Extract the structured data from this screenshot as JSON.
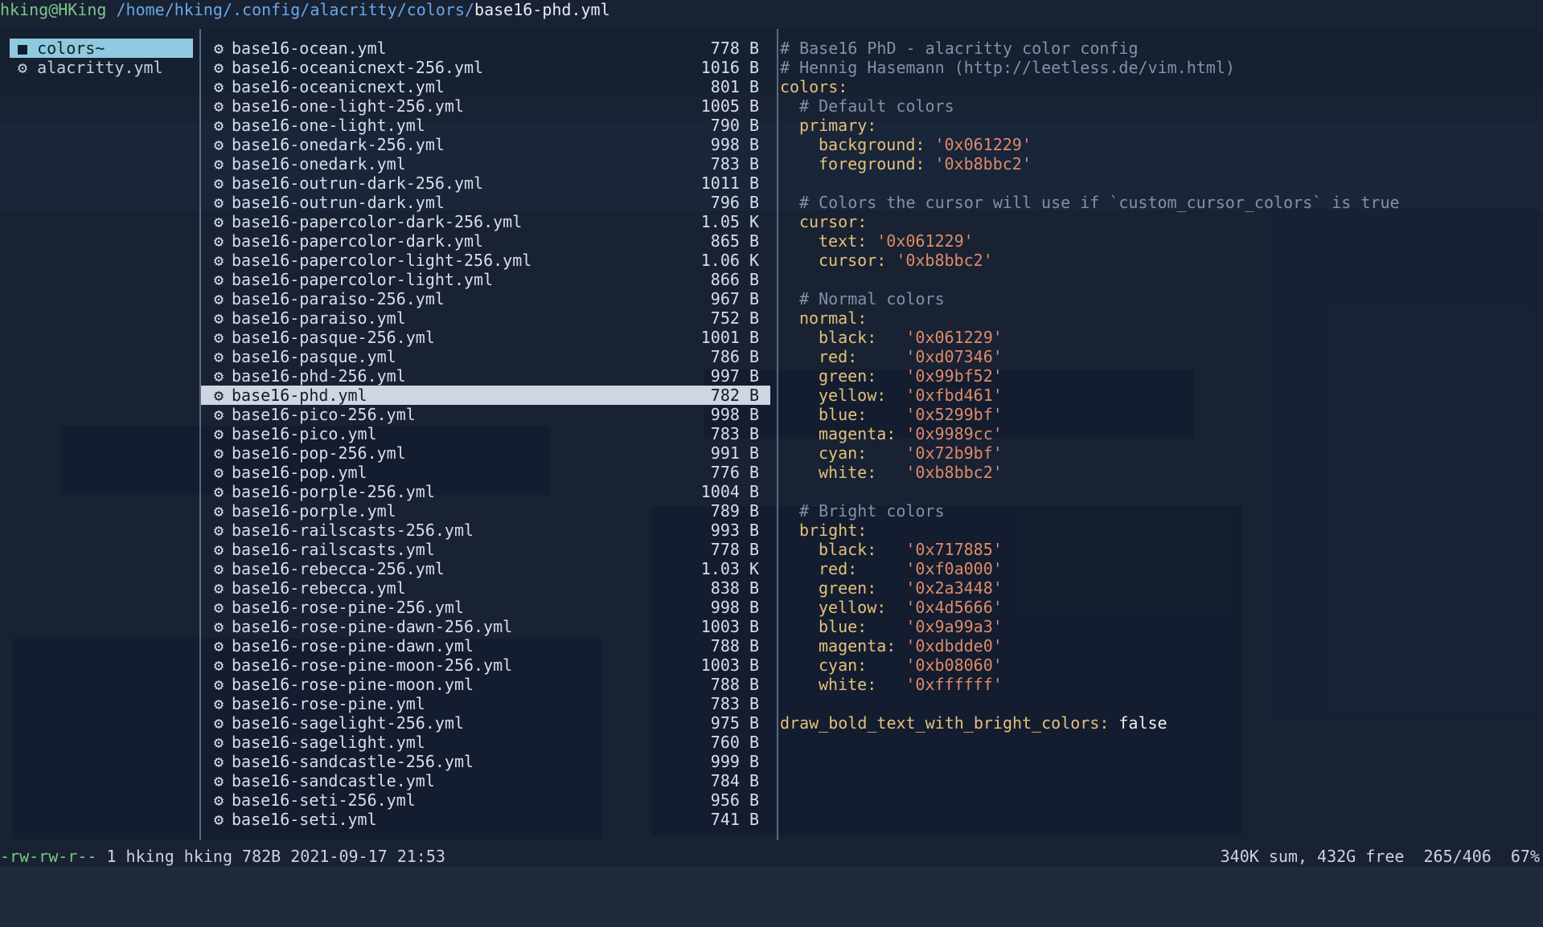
{
  "header": {
    "user_host": "hking@HKing",
    "path": "/home/hking/.config/alacritty/colors/",
    "file": "base16-phd.yml"
  },
  "parent_dir": [
    {
      "icon": "folder-icon",
      "name": "colors~",
      "selected": true
    },
    {
      "icon": "gear-icon",
      "name": "alacritty.yml",
      "selected": false
    }
  ],
  "files": [
    {
      "name": "base16-ocean.yml",
      "size": "778 B"
    },
    {
      "name": "base16-oceanicnext-256.yml",
      "size": "1016 B"
    },
    {
      "name": "base16-oceanicnext.yml",
      "size": "801 B"
    },
    {
      "name": "base16-one-light-256.yml",
      "size": "1005 B"
    },
    {
      "name": "base16-one-light.yml",
      "size": "790 B"
    },
    {
      "name": "base16-onedark-256.yml",
      "size": "998 B"
    },
    {
      "name": "base16-onedark.yml",
      "size": "783 B"
    },
    {
      "name": "base16-outrun-dark-256.yml",
      "size": "1011 B"
    },
    {
      "name": "base16-outrun-dark.yml",
      "size": "796 B"
    },
    {
      "name": "base16-papercolor-dark-256.yml",
      "size": "1.05 K"
    },
    {
      "name": "base16-papercolor-dark.yml",
      "size": "865 B"
    },
    {
      "name": "base16-papercolor-light-256.yml",
      "size": "1.06 K"
    },
    {
      "name": "base16-papercolor-light.yml",
      "size": "866 B"
    },
    {
      "name": "base16-paraiso-256.yml",
      "size": "967 B"
    },
    {
      "name": "base16-paraiso.yml",
      "size": "752 B"
    },
    {
      "name": "base16-pasque-256.yml",
      "size": "1001 B"
    },
    {
      "name": "base16-pasque.yml",
      "size": "786 B"
    },
    {
      "name": "base16-phd-256.yml",
      "size": "997 B"
    },
    {
      "name": "base16-phd.yml",
      "size": "782 B",
      "selected": true
    },
    {
      "name": "base16-pico-256.yml",
      "size": "998 B"
    },
    {
      "name": "base16-pico.yml",
      "size": "783 B"
    },
    {
      "name": "base16-pop-256.yml",
      "size": "991 B"
    },
    {
      "name": "base16-pop.yml",
      "size": "776 B"
    },
    {
      "name": "base16-porple-256.yml",
      "size": "1004 B"
    },
    {
      "name": "base16-porple.yml",
      "size": "789 B"
    },
    {
      "name": "base16-railscasts-256.yml",
      "size": "993 B"
    },
    {
      "name": "base16-railscasts.yml",
      "size": "778 B"
    },
    {
      "name": "base16-rebecca-256.yml",
      "size": "1.03 K"
    },
    {
      "name": "base16-rebecca.yml",
      "size": "838 B"
    },
    {
      "name": "base16-rose-pine-256.yml",
      "size": "998 B"
    },
    {
      "name": "base16-rose-pine-dawn-256.yml",
      "size": "1003 B"
    },
    {
      "name": "base16-rose-pine-dawn.yml",
      "size": "788 B"
    },
    {
      "name": "base16-rose-pine-moon-256.yml",
      "size": "1003 B"
    },
    {
      "name": "base16-rose-pine-moon.yml",
      "size": "788 B"
    },
    {
      "name": "base16-rose-pine.yml",
      "size": "783 B"
    },
    {
      "name": "base16-sagelight-256.yml",
      "size": "975 B"
    },
    {
      "name": "base16-sagelight.yml",
      "size": "760 B"
    },
    {
      "name": "base16-sandcastle-256.yml",
      "size": "999 B"
    },
    {
      "name": "base16-sandcastle.yml",
      "size": "784 B"
    },
    {
      "name": "base16-seti-256.yml",
      "size": "956 B"
    },
    {
      "name": "base16-seti.yml",
      "size": "741 B"
    }
  ],
  "preview": [
    {
      "type": "comment",
      "indent": 0,
      "text": "# Base16 PhD - alacritty color config"
    },
    {
      "type": "comment",
      "indent": 0,
      "text": "# Hennig Hasemann (http://leetless.de/vim.html)"
    },
    {
      "type": "key",
      "indent": 0,
      "key": "colors:",
      "value": ""
    },
    {
      "type": "comment",
      "indent": 1,
      "text": "# Default colors"
    },
    {
      "type": "key",
      "indent": 1,
      "key": "primary:",
      "value": ""
    },
    {
      "type": "key",
      "indent": 2,
      "key": "background:",
      "value": "'0x061229'"
    },
    {
      "type": "key",
      "indent": 2,
      "key": "foreground:",
      "value": "'0xb8bbc2'"
    },
    {
      "type": "blank"
    },
    {
      "type": "comment",
      "indent": 1,
      "text": "# Colors the cursor will use if `custom_cursor_colors` is true"
    },
    {
      "type": "key",
      "indent": 1,
      "key": "cursor:",
      "value": ""
    },
    {
      "type": "key",
      "indent": 2,
      "key": "text:",
      "value": "'0x061229'"
    },
    {
      "type": "key",
      "indent": 2,
      "key": "cursor:",
      "value": "'0xb8bbc2'"
    },
    {
      "type": "blank"
    },
    {
      "type": "comment",
      "indent": 1,
      "text": "# Normal colors"
    },
    {
      "type": "key",
      "indent": 1,
      "key": "normal:",
      "value": ""
    },
    {
      "type": "key",
      "indent": 2,
      "key": "black:",
      "value": "'0x061229'"
    },
    {
      "type": "key",
      "indent": 2,
      "key": "red:",
      "value": "'0xd07346'"
    },
    {
      "type": "key",
      "indent": 2,
      "key": "green:",
      "value": "'0x99bf52'"
    },
    {
      "type": "key",
      "indent": 2,
      "key": "yellow:",
      "value": "'0xfbd461'"
    },
    {
      "type": "key",
      "indent": 2,
      "key": "blue:",
      "value": "'0x5299bf'"
    },
    {
      "type": "key",
      "indent": 2,
      "key": "magenta:",
      "value": "'0x9989cc'"
    },
    {
      "type": "key",
      "indent": 2,
      "key": "cyan:",
      "value": "'0x72b9bf'"
    },
    {
      "type": "key",
      "indent": 2,
      "key": "white:",
      "value": "'0xb8bbc2'"
    },
    {
      "type": "blank"
    },
    {
      "type": "comment",
      "indent": 1,
      "text": "# Bright colors"
    },
    {
      "type": "key",
      "indent": 1,
      "key": "bright:",
      "value": ""
    },
    {
      "type": "key",
      "indent": 2,
      "key": "black:",
      "value": "'0x717885'"
    },
    {
      "type": "key",
      "indent": 2,
      "key": "red:",
      "value": "'0xf0a000'"
    },
    {
      "type": "key",
      "indent": 2,
      "key": "green:",
      "value": "'0x2a3448'"
    },
    {
      "type": "key",
      "indent": 2,
      "key": "yellow:",
      "value": "'0x4d5666'"
    },
    {
      "type": "key",
      "indent": 2,
      "key": "blue:",
      "value": "'0x9a99a3'"
    },
    {
      "type": "key",
      "indent": 2,
      "key": "magenta:",
      "value": "'0xdbdde0'"
    },
    {
      "type": "key",
      "indent": 2,
      "key": "cyan:",
      "value": "'0xb08060'"
    },
    {
      "type": "key",
      "indent": 2,
      "key": "white:",
      "value": "'0xffffff'"
    },
    {
      "type": "blank"
    },
    {
      "type": "kvplain",
      "indent": 0,
      "key": "draw_bold_text_with_bright_colors:",
      "value": "false"
    }
  ],
  "status": {
    "permissions": "-rw-rw-r--",
    "info": " 1 hking hking 782B 2021-09-17 21:53",
    "right": "340K sum, 432G free  265/406  67%"
  },
  "colors": {
    "selection_dir": "#8fc9dd",
    "selection_file": "#cfd6e2",
    "key": "#e5c07b",
    "value": "#e08a6a",
    "comment": "#8390a8"
  }
}
